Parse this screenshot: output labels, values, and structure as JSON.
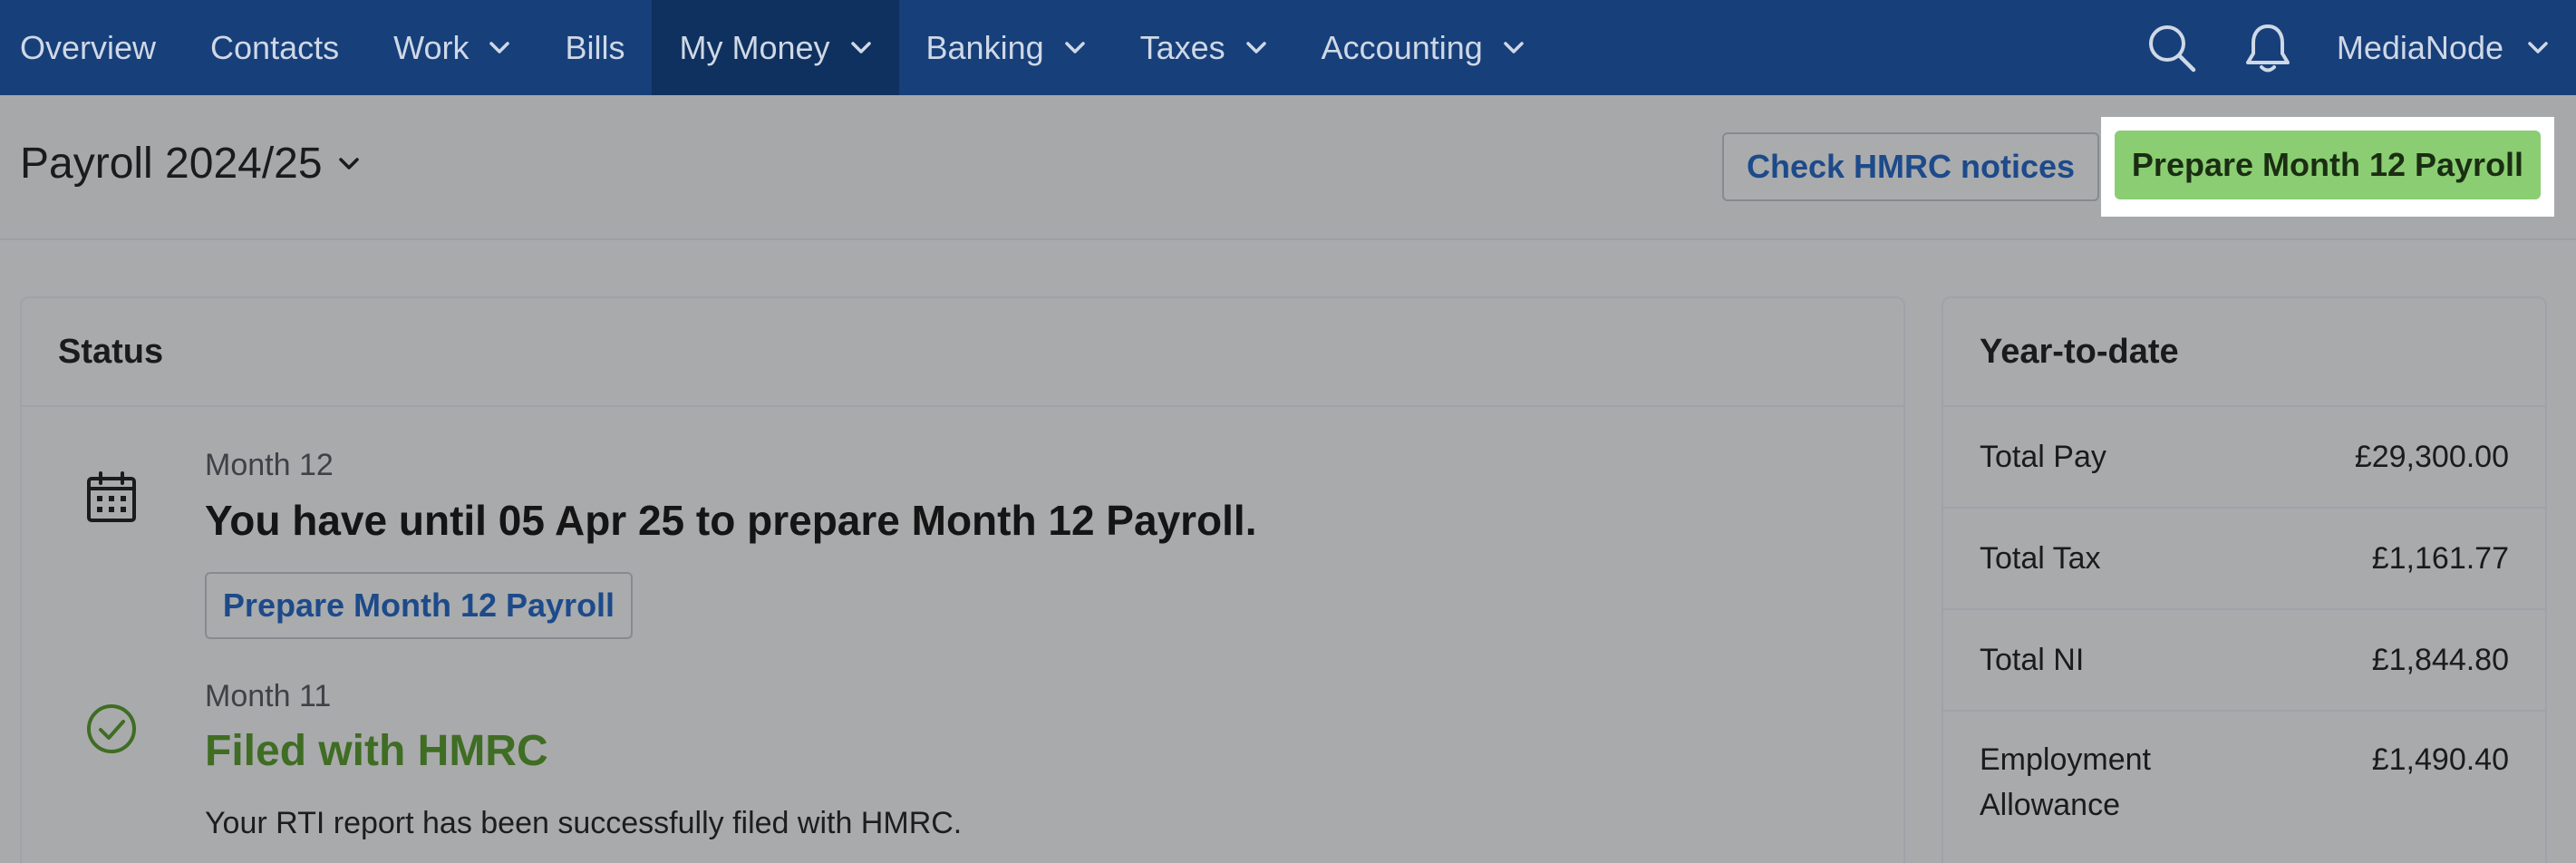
{
  "nav": {
    "items": [
      {
        "label": "Overview",
        "dropdown": false,
        "active": false
      },
      {
        "label": "Contacts",
        "dropdown": false,
        "active": false
      },
      {
        "label": "Work",
        "dropdown": true,
        "active": false
      },
      {
        "label": "Bills",
        "dropdown": false,
        "active": false
      },
      {
        "label": "My Money",
        "dropdown": true,
        "active": true
      },
      {
        "label": "Banking",
        "dropdown": true,
        "active": false
      },
      {
        "label": "Taxes",
        "dropdown": true,
        "active": false
      },
      {
        "label": "Accounting",
        "dropdown": true,
        "active": false
      }
    ],
    "account": "MediaNode",
    "icons": [
      "search-icon",
      "bell-icon"
    ]
  },
  "header": {
    "title": "Payroll 2024/25",
    "check_notices_label": "Check HMRC notices",
    "prepare_label": "Prepare Month 12 Payroll"
  },
  "status": {
    "title": "Status",
    "month12": {
      "label": "Month 12",
      "headline": "You have until 05 Apr 25 to prepare Month 12 Payroll.",
      "button": "Prepare Month 12 Payroll",
      "icon": "calendar-icon"
    },
    "month11": {
      "label": "Month 11",
      "headline": "Filed with HMRC",
      "text": "Your RTI report has been successfully filed with HMRC.",
      "icon": "check-circle-icon"
    }
  },
  "ytd": {
    "title": "Year-to-date",
    "rows": [
      {
        "label": "Total Pay",
        "value": "£29,300.00"
      },
      {
        "label": "Total Tax",
        "value": "£1,161.77"
      },
      {
        "label": "Total NI",
        "value": "£1,844.80"
      },
      {
        "label": "Employment\nAllowance",
        "value": "£1,490.40"
      }
    ]
  },
  "colors": {
    "nav_bg": "#173f7a",
    "nav_active": "#0f315f",
    "primary_green": "#8bcd73",
    "link_blue": "#1d4a8a",
    "success_green": "#3f6d23"
  }
}
